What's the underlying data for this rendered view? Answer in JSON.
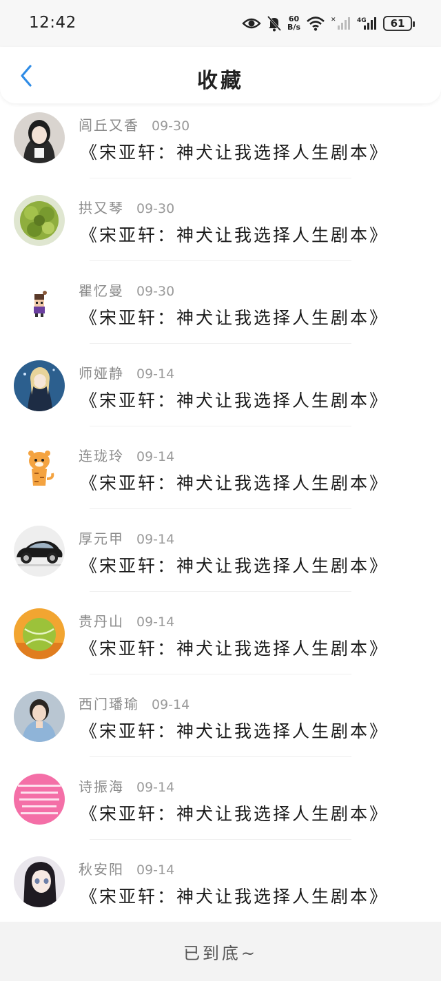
{
  "status": {
    "time": "12:42",
    "net_speed_value": "60",
    "net_speed_unit": "B/s",
    "network": "4G",
    "battery": "61"
  },
  "header": {
    "title": "收藏",
    "back_icon": "chevron-left-icon"
  },
  "colors": {
    "accent": "#2f8ce6",
    "name_text": "#8a8a8a",
    "title_text": "#1a1a1a",
    "footer_bg": "#f3f3f3"
  },
  "items": [
    {
      "name": "闾丘又香",
      "date": "09-30",
      "title": "《宋亚轩：神犬让我选择人生剧本》",
      "avatar": "girl-portrait"
    },
    {
      "name": "拱又琴",
      "date": "09-30",
      "title": "《宋亚轩：神犬让我选择人生剧本》",
      "avatar": "green-wreath"
    },
    {
      "name": "瞿忆曼",
      "date": "09-30",
      "title": "《宋亚轩：神犬让我选择人生剧本》",
      "avatar": "pixel-character"
    },
    {
      "name": "师娅静",
      "date": "09-14",
      "title": "《宋亚轩：神犬让我选择人生剧本》",
      "avatar": "anime-blonde"
    },
    {
      "name": "连珑玲",
      "date": "09-14",
      "title": "《宋亚轩：神犬让我选择人生剧本》",
      "avatar": "cartoon-tiger"
    },
    {
      "name": "厚元甲",
      "date": "09-14",
      "title": "《宋亚轩：神犬让我选择人生剧本》",
      "avatar": "black-car"
    },
    {
      "name": "贵丹山",
      "date": "09-14",
      "title": "《宋亚轩：神犬让我选择人生剧本》",
      "avatar": "tennis-ball"
    },
    {
      "name": "西门璠瑜",
      "date": "09-14",
      "title": "《宋亚轩：神犬让我选择人生剧本》",
      "avatar": "boy-portrait"
    },
    {
      "name": "诗振海",
      "date": "09-14",
      "title": "《宋亚轩：神犬让我选择人生剧本》",
      "avatar": "pink-text-card"
    },
    {
      "name": "秋安阳",
      "date": "09-14",
      "title": "《宋亚轩：神犬让我选择人生剧本》",
      "avatar": "anime-dark-hair"
    }
  ],
  "footer": {
    "end_text": "已到底~"
  }
}
